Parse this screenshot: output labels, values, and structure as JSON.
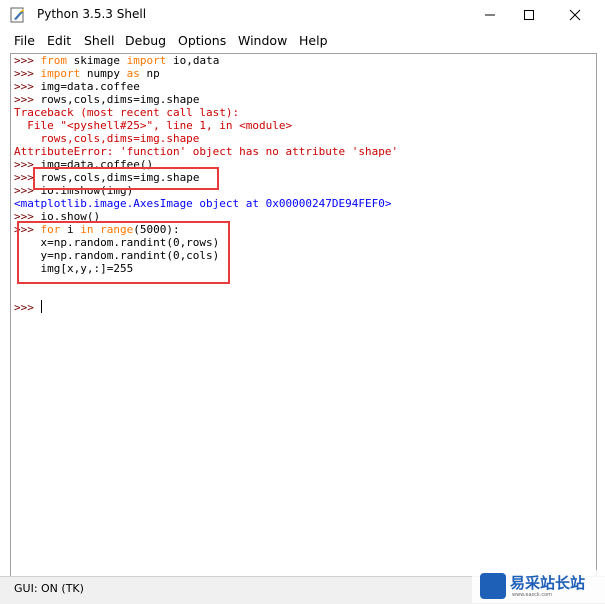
{
  "window": {
    "title": "Python 3.5.3 Shell",
    "icon": "python-feather-icon"
  },
  "menu": [
    "File",
    "Edit",
    "Shell",
    "Debug",
    "Options",
    "Window",
    "Help"
  ],
  "status": "GUI: ON (TK)",
  "watermark": {
    "title": "易采站长站",
    "subtitle": "www.easck.com"
  },
  "lines": [
    {
      "prompt": ">>> ",
      "segs": [
        [
          "kw",
          "from"
        ],
        [
          "",
          " skimage "
        ],
        [
          "kw",
          "import"
        ],
        [
          "",
          " io,data"
        ]
      ]
    },
    {
      "prompt": ">>> ",
      "segs": [
        [
          "kw",
          "import"
        ],
        [
          "",
          " numpy "
        ],
        [
          "kw",
          "as"
        ],
        [
          "",
          " np"
        ]
      ]
    },
    {
      "prompt": ">>> ",
      "segs": [
        [
          "",
          "img=data.coffee"
        ]
      ]
    },
    {
      "prompt": ">>> ",
      "segs": [
        [
          "",
          "rows,cols,dims=img.shape"
        ]
      ]
    },
    {
      "prompt": "",
      "segs": [
        [
          "err",
          "Traceback (most recent call last):"
        ]
      ]
    },
    {
      "prompt": "",
      "segs": [
        [
          "err",
          "  File \"<pyshell#25>\", line 1, in <module>"
        ]
      ]
    },
    {
      "prompt": "",
      "segs": [
        [
          "err",
          "    rows,cols,dims=img.shape"
        ]
      ]
    },
    {
      "prompt": "",
      "segs": [
        [
          "err",
          "AttributeError: 'function' object has no attribute 'shape'"
        ]
      ]
    },
    {
      "prompt": ">>> ",
      "segs": [
        [
          "",
          "img=data.coffee()"
        ]
      ]
    },
    {
      "prompt": ">>> ",
      "segs": [
        [
          "",
          "rows,cols,dims=img.shape"
        ]
      ]
    },
    {
      "prompt": ">>> ",
      "segs": [
        [
          "",
          "io.imshow(img)"
        ]
      ]
    },
    {
      "prompt": "",
      "segs": [
        [
          "out",
          "<matplotlib.image.AxesImage object at 0x00000247DE94FEF0>"
        ]
      ]
    },
    {
      "prompt": ">>> ",
      "segs": [
        [
          "",
          "io.show()"
        ]
      ]
    },
    {
      "prompt": ">>> ",
      "segs": [
        [
          "kw",
          "for"
        ],
        [
          "",
          " i "
        ],
        [
          "kw",
          "in"
        ],
        [
          "",
          " "
        ],
        [
          "kw",
          "range"
        ],
        [
          "",
          "(5000):"
        ]
      ]
    },
    {
      "prompt": "",
      "segs": [
        [
          "",
          "    x=np.random.randint(0,rows)"
        ]
      ]
    },
    {
      "prompt": "",
      "segs": [
        [
          "",
          "    y=np.random.randint(0,cols)"
        ]
      ]
    },
    {
      "prompt": "",
      "segs": [
        [
          "",
          "    img[x,y,:]=255"
        ]
      ]
    },
    {
      "prompt": "",
      "segs": [
        [
          "",
          ""
        ]
      ]
    },
    {
      "prompt": "",
      "segs": [
        [
          "",
          ""
        ]
      ]
    },
    {
      "prompt": ">>> ",
      "segs": [
        [
          "",
          ""
        ]
      ]
    }
  ]
}
